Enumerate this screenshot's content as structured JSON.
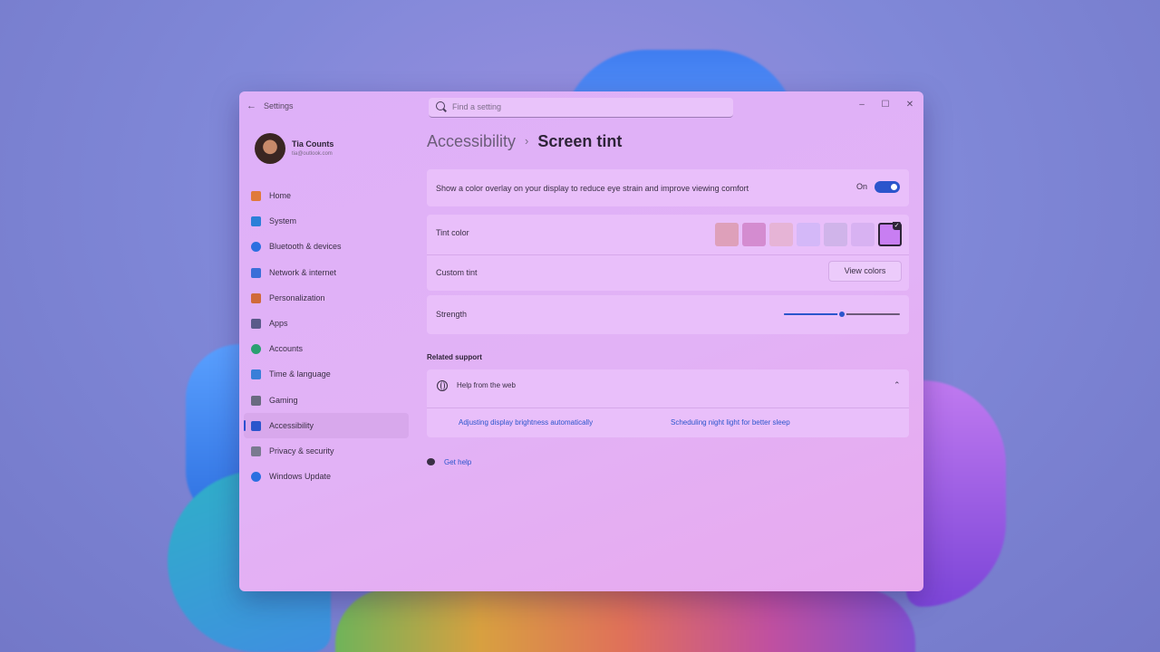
{
  "window": {
    "title": "Settings",
    "search_placeholder": "Find a setting",
    "controls": {
      "minimize": "–",
      "maximize": "☐",
      "close": "✕"
    }
  },
  "profile": {
    "name": "Tia Counts",
    "email": "tia@outlook.com"
  },
  "sidebar": {
    "items": [
      {
        "label": "Home",
        "icon": "home-icon",
        "color": "#e07a3a"
      },
      {
        "label": "System",
        "icon": "system-icon",
        "color": "#2b7fd8"
      },
      {
        "label": "Bluetooth & devices",
        "icon": "bluetooth-icon",
        "color": "#2b6fe0"
      },
      {
        "label": "Network & internet",
        "icon": "network-icon",
        "color": "#3a6fd8"
      },
      {
        "label": "Personalization",
        "icon": "brush-icon",
        "color": "#d06a3a"
      },
      {
        "label": "Apps",
        "icon": "apps-icon",
        "color": "#5a5a8a"
      },
      {
        "label": "Accounts",
        "icon": "accounts-icon",
        "color": "#2aa070"
      },
      {
        "label": "Time & language",
        "icon": "time-language-icon",
        "color": "#3a7fd8"
      },
      {
        "label": "Gaming",
        "icon": "gaming-icon",
        "color": "#6a6a80"
      },
      {
        "label": "Accessibility",
        "icon": "accessibility-icon",
        "color": "#2b55cc",
        "active": true
      },
      {
        "label": "Privacy & security",
        "icon": "shield-icon",
        "color": "#7a7a90"
      },
      {
        "label": "Windows Update",
        "icon": "update-icon",
        "color": "#2b6fe0"
      }
    ]
  },
  "breadcrumb": {
    "parent": "Accessibility",
    "separator": "›",
    "current": "Screen tint"
  },
  "overlay": {
    "description": "Show a color overlay on your display to reduce eye strain and improve viewing comfort",
    "state_label": "On",
    "enabled": true
  },
  "tint": {
    "label": "Tint color",
    "swatches": [
      "#dea0ba",
      "#d48cd0",
      "#e6b4d6",
      "#d4b8f8",
      "#d0b4ea",
      "#d8b2f2",
      "#c87ef2"
    ],
    "selected_index": 6,
    "custom_label": "Custom tint",
    "view_colors_label": "View colors"
  },
  "strength": {
    "label": "Strength",
    "value": 0.5
  },
  "related": {
    "title": "Related support",
    "help_label": "Help from the web",
    "chevron": "⌃",
    "links": [
      "Adjusting display brightness automatically",
      "Scheduling night light for better sleep"
    ]
  },
  "get_help": "Get help"
}
